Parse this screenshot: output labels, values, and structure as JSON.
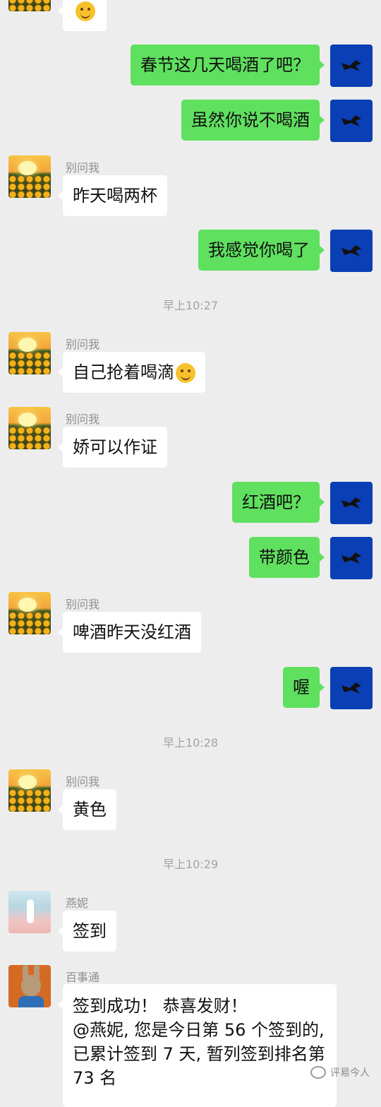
{
  "messages": [
    {
      "side": "in",
      "text": "",
      "emoji": "grin-emoji"
    },
    {
      "side": "out",
      "text": "春节这几天喝酒了吧？"
    },
    {
      "side": "out",
      "text": "虽然你说不喝酒"
    },
    {
      "side": "in",
      "sender": "别问我",
      "text": "昨天喝两杯"
    },
    {
      "side": "out",
      "text": "我感觉你喝了"
    },
    {
      "side": "in",
      "sender": "别问我",
      "text": "自己抢着喝滴",
      "emoji": "thinking-emoji"
    },
    {
      "side": "in",
      "sender": "别问我",
      "text": "娇可以作证"
    },
    {
      "side": "out",
      "text": "红酒吧？"
    },
    {
      "side": "out",
      "text": "带颜色"
    },
    {
      "side": "in",
      "sender": "别问我",
      "text": "啤酒昨天没红酒"
    },
    {
      "side": "out",
      "text": "喔"
    },
    {
      "side": "in",
      "sender": "别问我",
      "text": "黄色"
    },
    {
      "side": "in",
      "sender": "燕妮",
      "text": "签到"
    },
    {
      "side": "in",
      "sender": "百事通",
      "lines": [
        "签到成功！ 恭喜发财！",
        "@燕妮, 您是今日第 56 个签到的,",
        "已累计签到 7 天, 暂列签到排名第",
        "73 名"
      ]
    }
  ],
  "timestamps": [
    "早上10:27",
    "早上10:28",
    "早上10:29"
  ],
  "watermark": "评易今人",
  "colors": {
    "background": "#ededed",
    "outgoing_bubble": "#5fe05f",
    "incoming_bubble": "#ffffff",
    "self_avatar": "#0b3fb5"
  }
}
